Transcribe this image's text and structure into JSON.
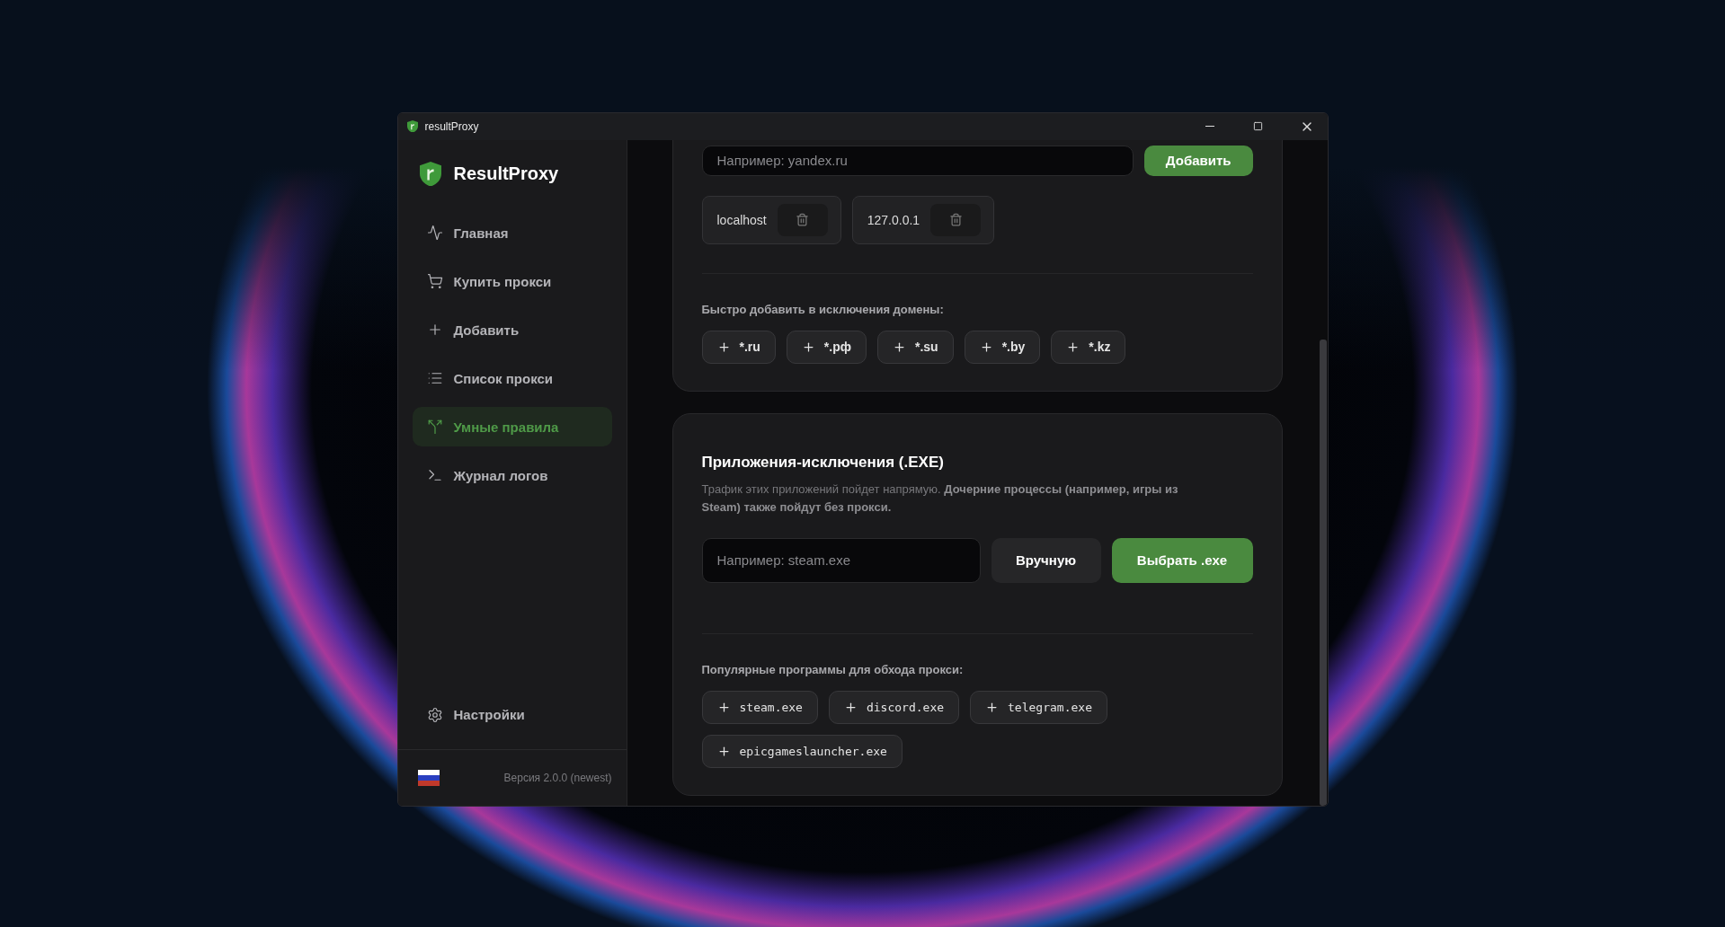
{
  "window": {
    "title": "resultProxy"
  },
  "sidebar": {
    "brand": "ResultProxy",
    "nav": [
      {
        "kind": "activity",
        "label": "Главная",
        "selected": false
      },
      {
        "kind": "cart",
        "label": "Купить прокси",
        "selected": false
      },
      {
        "kind": "plus",
        "label": "Добавить",
        "selected": false
      },
      {
        "kind": "list",
        "label": "Список прокси",
        "selected": false
      },
      {
        "kind": "split",
        "label": "Умные правила",
        "selected": true
      },
      {
        "kind": "terminal",
        "label": "Журнал логов",
        "selected": false
      }
    ],
    "settings": {
      "label": "Настройки"
    },
    "version": "Версия 2.0.0 (newest)"
  },
  "domains": {
    "input": {
      "placeholder": "Например: yandex.ru"
    },
    "add_button": "Добавить",
    "entries": [
      {
        "text": "localhost"
      },
      {
        "text": "127.0.0.1"
      }
    ],
    "quick_label": "Быстро добавить в исключения домены:",
    "quick": [
      "*.ru",
      "*.рф",
      "*.su",
      "*.by",
      "*.kz"
    ]
  },
  "apps": {
    "title": "Приложения-исключения (.EXE)",
    "description": "Трафик этих приложений пойдет напрямую. **Дочерние процессы (например, игры из Steam) также пойдут без прокси.**",
    "input": {
      "placeholder": "Например: steam.exe"
    },
    "manual_button": "Вручную",
    "pick_button": "Выбрать .exe",
    "popular_label": "Популярные программы для обхода прокси:",
    "popular": [
      "steam.exe",
      "discord.exe",
      "telegram.exe",
      "epicgameslauncher.exe"
    ]
  }
}
